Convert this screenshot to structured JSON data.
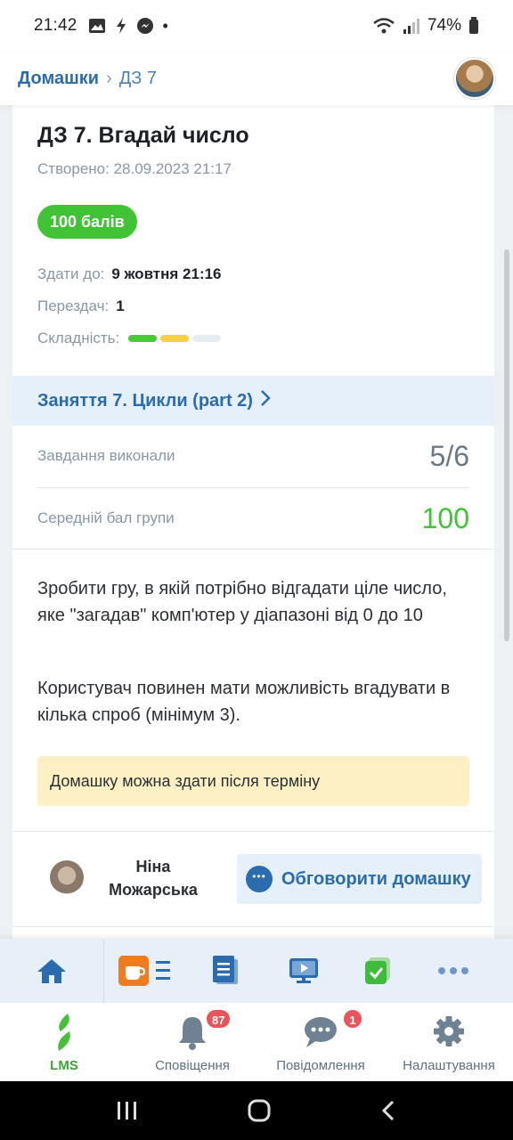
{
  "status_bar": {
    "time": "21:42",
    "battery": "74%"
  },
  "breadcrumb": {
    "parent": "Домашки",
    "current": "ДЗ 7"
  },
  "homework": {
    "title": "ДЗ 7. Вгадай число",
    "created_label": "Створено:",
    "created_value": "28.09.2023 21:17",
    "points": "100 балів",
    "deadline_label": "Здати до:",
    "deadline_value": "9 жовтня 21:16",
    "resubmits_label": "Перездач:",
    "resubmits_value": "1",
    "difficulty_label": "Складність:",
    "difficulty_levels": 3,
    "difficulty_filled": 2,
    "difficulty_colors": [
      "#4cc93a",
      "#f5d23c",
      "#e7ecf1"
    ]
  },
  "lesson": {
    "title": "Заняття 7. Цикли (part 2)"
  },
  "stats": {
    "completed_label": "Завдання виконали",
    "completed_value": "5/6",
    "avg_label": "Середній бал групи",
    "avg_value": "100"
  },
  "description": {
    "paragraph1": "Зробити гру, в якій потрібно відгадати ціле число, яке \"загадав\" комп'ютер у діапазоні від 0 до 10",
    "paragraph2": "Користувач повинен мати можливість вгадувати в кілька спроб (мінімум 3)."
  },
  "notice": "Домашку можна здати після терміну",
  "author": {
    "name": "Ніна Можарська"
  },
  "discuss_button": "Обговорити домашку",
  "bottom_nav": {
    "lms": "LMS",
    "notifications": "Сповіщення",
    "notifications_count": "87",
    "messages": "Повідомлення",
    "messages_count": "1",
    "settings": "Налаштування"
  },
  "colors": {
    "accent": "#2a6cad",
    "success": "#41c336",
    "badge": "#e8545a"
  }
}
